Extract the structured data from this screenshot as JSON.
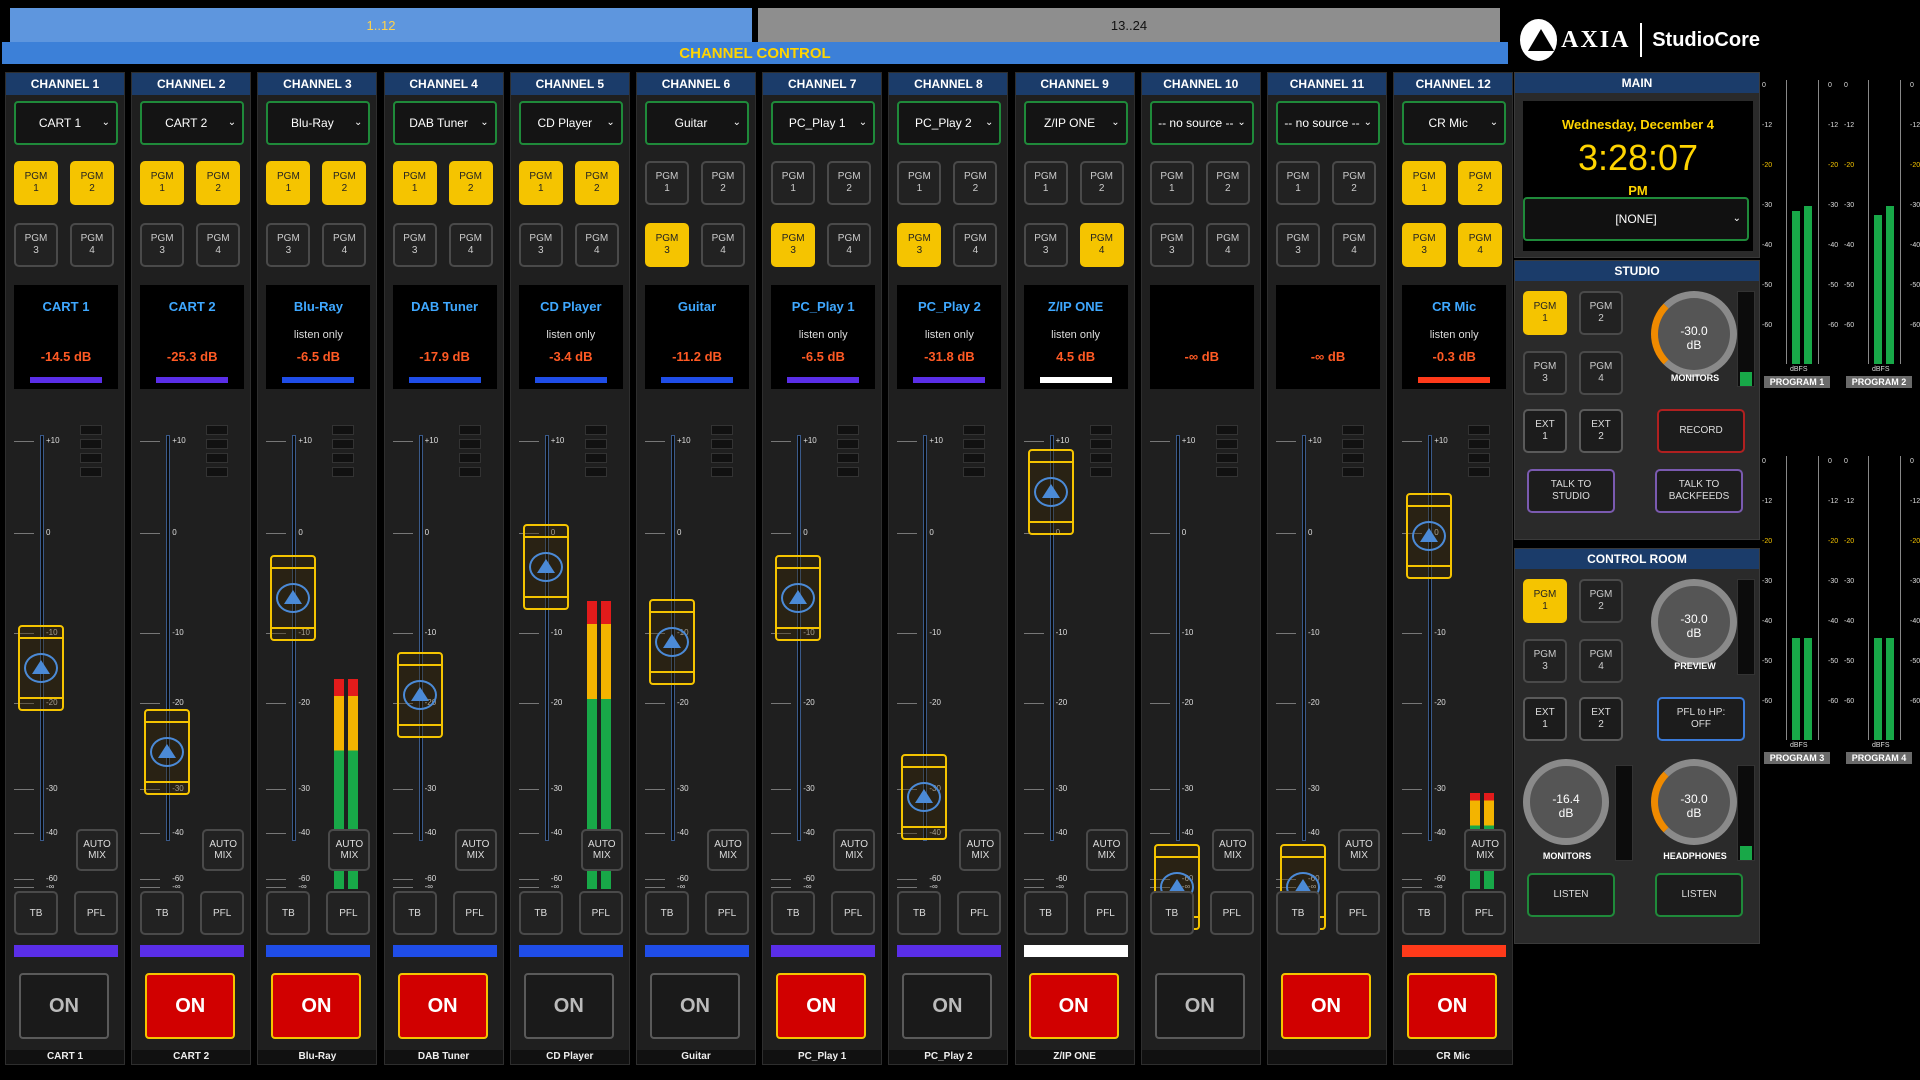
{
  "tabs": [
    "1..12",
    "13..24"
  ],
  "channel_control_title": "CHANNEL CONTROL",
  "brand": {
    "axia": "AXIA",
    "studiocore": "StudioCore"
  },
  "scale_labels": [
    "+10",
    "0",
    "-10",
    "-20",
    "-30",
    "-40",
    "-60",
    "-∞"
  ],
  "channels": [
    {
      "header": "CHANNEL 1",
      "source": "CART 1",
      "pgm": [
        true,
        true,
        false,
        false
      ],
      "name": "CART 1",
      "listen": "",
      "db": "-14.5 dB",
      "bar": "#5a2ee8",
      "level": -14.5,
      "on": false,
      "on_label": "ON",
      "foot": "CART 1",
      "meter": 0,
      "color": "#5a2ee8"
    },
    {
      "header": "CHANNEL 2",
      "source": "CART 2",
      "pgm": [
        true,
        true,
        false,
        false
      ],
      "name": "CART 2",
      "listen": "",
      "db": "-25.3 dB",
      "bar": "#5a2ee8",
      "level": -25.3,
      "on": true,
      "on_label": "ON",
      "foot": "CART 2",
      "meter": 0,
      "color": "#5a2ee8"
    },
    {
      "header": "CHANNEL 3",
      "source": "Blu-Ray",
      "pgm": [
        true,
        true,
        false,
        false
      ],
      "name": "Blu-Ray",
      "listen": "listen only",
      "db": "-6.5 dB",
      "bar": "#1f4de8",
      "level": -6.5,
      "on": true,
      "on_label": "ON",
      "foot": "Blu-Ray",
      "meter": 0.7,
      "color": "#1f4de8"
    },
    {
      "header": "CHANNEL 4",
      "source": "DAB Tuner",
      "pgm": [
        true,
        true,
        false,
        false
      ],
      "name": "DAB Tuner",
      "listen": "",
      "db": "-17.9 dB",
      "bar": "#1f4de8",
      "level": -17.9,
      "on": true,
      "on_label": "ON",
      "foot": "DAB Tuner",
      "meter": 0,
      "color": "#1f4de8"
    },
    {
      "header": "CHANNEL 5",
      "source": "CD Player",
      "pgm": [
        true,
        true,
        false,
        false
      ],
      "name": "CD Player",
      "listen": "listen only",
      "db": "-3.4 dB",
      "bar": "#1f4de8",
      "level": -3.4,
      "on": false,
      "on_label": "ON",
      "foot": "CD Player",
      "meter": 0.96,
      "color": "#1f4de8"
    },
    {
      "header": "CHANNEL 6",
      "source": "Guitar",
      "pgm": [
        false,
        false,
        true,
        false
      ],
      "name": "Guitar",
      "listen": "",
      "db": "-11.2 dB",
      "bar": "#1f4de8",
      "level": -11.2,
      "on": false,
      "on_label": "ON",
      "foot": "Guitar",
      "meter": 0,
      "color": "#1f4de8"
    },
    {
      "header": "CHANNEL 7",
      "source": "PC_Play 1",
      "pgm": [
        false,
        false,
        true,
        false
      ],
      "name": "PC_Play 1",
      "listen": "listen only",
      "db": "-6.5 dB",
      "bar": "#5a2ee8",
      "level": -6.5,
      "on": true,
      "on_label": "ON",
      "foot": "PC_Play 1",
      "meter": 0,
      "color": "#5a2ee8"
    },
    {
      "header": "CHANNEL 8",
      "source": "PC_Play 2",
      "pgm": [
        false,
        false,
        true,
        false
      ],
      "name": "PC_Play 2",
      "listen": "listen only",
      "db": "-31.8 dB",
      "bar": "#5a2ee8",
      "level": -31.8,
      "on": false,
      "on_label": "ON",
      "foot": "PC_Play 2",
      "meter": 0,
      "color": "#5a2ee8"
    },
    {
      "header": "CHANNEL 9",
      "source": "Z/IP ONE",
      "pgm": [
        false,
        false,
        false,
        true
      ],
      "name": "Z/IP ONE",
      "listen": "listen only",
      "db": "4.5 dB",
      "bar": "#ffffff",
      "level": 4.5,
      "on": true,
      "on_label": "ON",
      "foot": "Z/IP ONE",
      "meter": 0,
      "color": "#ffffff"
    },
    {
      "header": "CHANNEL 10",
      "source": "-- no source --",
      "pgm": [
        false,
        false,
        false,
        false
      ],
      "name": "",
      "listen": "",
      "db": "-∞ dB",
      "bar": "",
      "level": -100,
      "on": false,
      "on_label": "ON",
      "foot": "",
      "meter": 0,
      "color": ""
    },
    {
      "header": "CHANNEL 11",
      "source": "-- no source --",
      "pgm": [
        false,
        false,
        false,
        false
      ],
      "name": "",
      "listen": "",
      "db": "-∞ dB",
      "bar": "",
      "level": -100,
      "on": true,
      "on_label": "ON",
      "foot": "",
      "meter": 0,
      "color": ""
    },
    {
      "header": "CHANNEL 12",
      "source": "CR Mic",
      "pgm": [
        true,
        true,
        true,
        true
      ],
      "name": "CR Mic",
      "listen": "listen only",
      "db": "-0.3 dB",
      "bar": "#ff3a1a",
      "level": -0.3,
      "on": true,
      "on_label": "ON",
      "foot": "CR Mic",
      "meter": 0.32,
      "color": "#ff3a1a"
    }
  ],
  "pgm_labels": [
    "PGM\n1",
    "PGM\n2",
    "PGM\n3",
    "PGM\n4"
  ],
  "auto_mix_label": "AUTO\nMIX",
  "tb_label": "TB",
  "pfl_label": "PFL",
  "main": {
    "title": "MAIN",
    "date": "Wednesday, December 4",
    "time": "3:28:07",
    "ampm": "PM",
    "select": "[NONE]"
  },
  "studio": {
    "title": "STUDIO",
    "pgm": [
      true,
      false,
      false,
      false
    ],
    "ext": [
      "EXT\n1",
      "EXT\n2"
    ],
    "record": "RECORD",
    "talk_studio": "TALK TO\nSTUDIO",
    "talk_backfeeds": "TALK TO\nBACKFEEDS",
    "monitor_val": "-30.0\ndB",
    "monitor_label": "MONITORS"
  },
  "control_room": {
    "title": "CONTROL ROOM",
    "pgm": [
      true,
      false,
      false,
      false
    ],
    "ext": [
      "EXT\n1",
      "EXT\n2"
    ],
    "preview_val": "-30.0\ndB",
    "preview_label": "PREVIEW",
    "pfl_hp": "PFL to HP:\nOFF",
    "monitors_val": "-16.4\ndB",
    "monitors_label": "MONITORS",
    "headphones_val": "-30.0\ndB",
    "headphones_label": "HEADPHONES",
    "listen1": "LISTEN",
    "listen2": "LISTEN"
  },
  "meters": {
    "scale": [
      "0",
      "-12",
      "-20",
      "-30",
      "-40",
      "-50",
      "-60"
    ],
    "unit": "dBFS",
    "program_labels": [
      "PROGRAM 1",
      "PROGRAM 2",
      "PROGRAM 3",
      "PROGRAM 4"
    ],
    "levels": [
      [
        0.36,
        0.37
      ],
      [
        0.35,
        0.37
      ],
      [
        0.24,
        0.24
      ],
      [
        0.24,
        0.24
      ]
    ]
  }
}
